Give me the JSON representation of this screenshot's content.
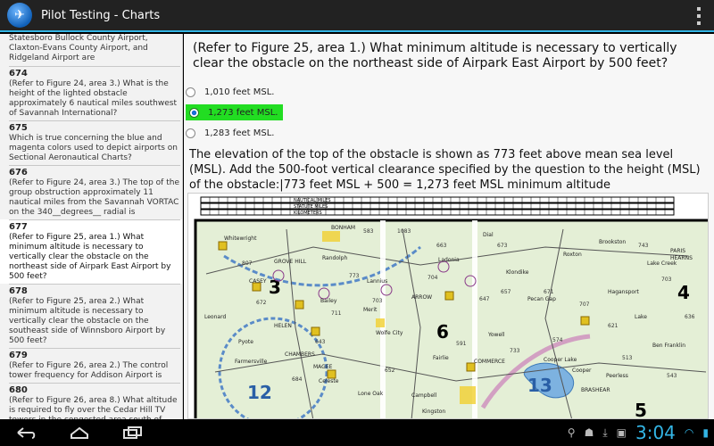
{
  "app": {
    "title": "Pilot Testing - Charts",
    "icon": "airplane-icon"
  },
  "list": {
    "first_text": "Statesboro Bullock County Airport, Claxton-Evans County Airport, and Ridgeland Airport are",
    "items": [
      {
        "num": "674",
        "text": "(Refer to Figure 24, area 3.) What is the height of the lighted obstacle approximately 6 nautical miles southwest of Savannah International?"
      },
      {
        "num": "675",
        "text": "Which is true concerning the blue and magenta colors used to depict airports on Sectional Aeronautical Charts?"
      },
      {
        "num": "676",
        "text": "(Refer to Figure 24, area 3.) The top of the group obstruction approximately 11 nautical miles from the Savannah VORTAC on the 340__degrees__ radial is"
      },
      {
        "num": "677",
        "text": "(Refer to Figure 25, area 1.) What minimum altitude is necessary to vertically clear the obstacle on the northeast side of Airpark East Airport by 500 feet?"
      },
      {
        "num": "678",
        "text": "(Refer to Figure 25, area 2.) What minimum altitude is necessary to vertically clear the obstacle on the southeast side of Winnsboro Airport by 500 feet?"
      },
      {
        "num": "679",
        "text": "(Refer to Figure 26, area 2.) The control tower frequency for Addison Airport is"
      },
      {
        "num": "680",
        "text": "(Refer to Figure 26, area 8.) What altitude is required to fly over the Cedar Hill TV towers in the congested area south of"
      }
    ]
  },
  "question": {
    "text": "(Refer to Figure 25, area 1.) What minimum altitude is necessary to vertically clear the obstacle on the northeast side of Airpark East Airport by 500 feet?",
    "options": [
      "1,010 feet MSL.",
      "1,273 feet MSL.",
      "1,283 feet MSL."
    ],
    "explanation": "The elevation of the top of the obstacle is shown as 773 feet above mean sea level (MSL). Add the 500-foot vertical clearance specified by the question to the height (MSL) of the obstacle:|773 feet MSL + 500 = 1,273 feet MSL minimum altitude"
  },
  "chart": {
    "scale_labels": [
      "NAUTICAL MILES",
      "STATUTE MILES",
      "KILOMETERS"
    ],
    "area_numbers": [
      "3",
      "4",
      "6",
      "12",
      "13",
      "5"
    ],
    "place_labels": [
      "Whitewright",
      "BONHAM",
      "Ladonia",
      "GROVE HILL",
      "CASEY",
      "Bailey",
      "Wolfe City",
      "Merit",
      "COMMERCE",
      "Yowell",
      "Fairlie",
      "MAGEE",
      "Celeste",
      "Lake Creek",
      "PARIS",
      "HEARNS",
      "BRASHEAR",
      "Cooper Lake",
      "Cooper",
      "Pecan Gap",
      "Klondike",
      "Lannius",
      "ARROW",
      "Randolph",
      "Dial",
      "Brookston",
      "Leonard",
      "Pyote",
      "Peerless",
      "HELEN",
      "CHAMBERS",
      "Lone Oak",
      "Campbell",
      "Kingston",
      "Ben Franklin",
      "Roxton",
      "Hagansport",
      "Lake",
      "Farmersville"
    ],
    "elevation_labels": [
      "583",
      "1083",
      "663",
      "673",
      "704",
      "647",
      "657",
      "671",
      "707",
      "703",
      "773",
      "711",
      "643",
      "591",
      "733",
      "621",
      "703",
      "743",
      "807",
      "672",
      "684",
      "652",
      "574",
      "513",
      "543",
      "636"
    ]
  },
  "status": {
    "clock": "3:04"
  }
}
